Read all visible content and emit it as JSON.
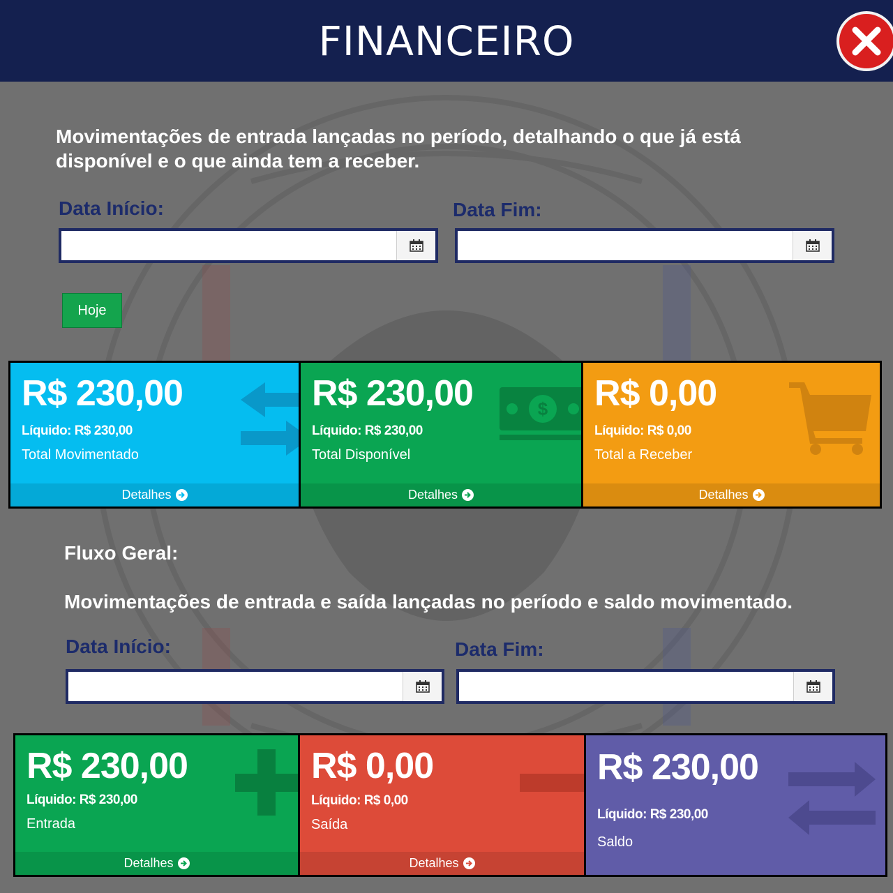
{
  "header": {
    "title": "FINANCEIRO",
    "close_icon": "close-icon"
  },
  "colors": {
    "header_bg": "#14204f",
    "label_blue": "#1c2b6b",
    "cyan": "#05bdf0",
    "green": "#0aa552",
    "orange": "#f39c12",
    "red": "#dd4b39",
    "purple": "#605ca8",
    "close_red": "#d91f1f"
  },
  "section1": {
    "description": "Movimentações de entrada lançadas no período, detalhando o que já está disponível e o que ainda tem a receber.",
    "start_label": "Data Início:",
    "end_label": "Data Fim:",
    "start_value": "",
    "end_value": "",
    "today_button": "Hoje",
    "cards": [
      {
        "amount": "R$ 230,00",
        "net": "Líquido: R$ 230,00",
        "caption": "Total Movimentado",
        "details": "Detalhes",
        "icon": "exchange-arrows-icon",
        "color": "#05bdf0"
      },
      {
        "amount": "R$ 230,00",
        "net": "Líquido: R$ 230,00",
        "caption": "Total Disponível",
        "details": "Detalhes",
        "icon": "money-bill-icon",
        "color": "#0aa552"
      },
      {
        "amount": "R$ 0,00",
        "net": "Líquido: R$ 0,00",
        "caption": "Total a Receber",
        "details": "Detalhes",
        "icon": "shopping-cart-icon",
        "color": "#f39c12"
      }
    ]
  },
  "section2": {
    "title": "Fluxo Geral:",
    "description": "Movimentações de entrada e saída lançadas no período e saldo movimentado.",
    "start_label": "Data Início:",
    "end_label": "Data Fim:",
    "start_value": "",
    "end_value": "",
    "cards": [
      {
        "amount": "R$ 230,00",
        "net": "Líquido: R$ 230,00",
        "caption": "Entrada",
        "details": "Detalhes",
        "icon": "plus-icon",
        "color": "#0aa552"
      },
      {
        "amount": "R$ 0,00",
        "net": "Líquido: R$ 0,00",
        "caption": "Saída",
        "details": "Detalhes",
        "icon": "minus-icon",
        "color": "#dd4b39"
      },
      {
        "amount": "R$ 230,00",
        "net": "Líquido: R$ 230,00",
        "caption": "Saldo",
        "icon": "exchange-arrows-icon",
        "color": "#605ca8"
      }
    ]
  }
}
